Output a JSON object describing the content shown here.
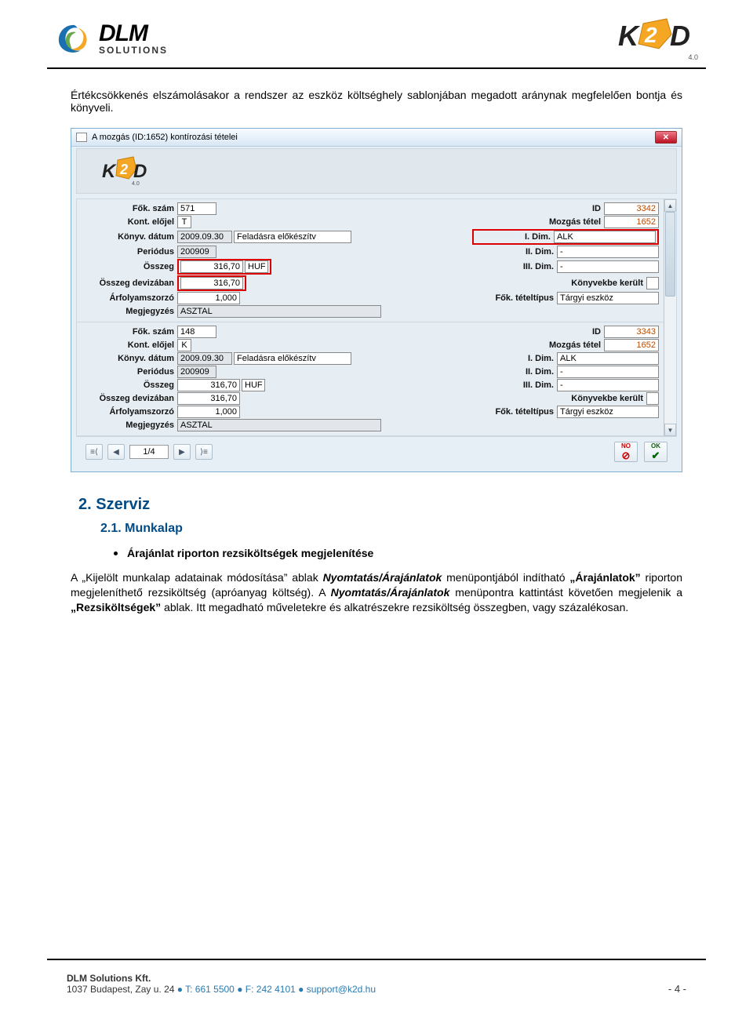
{
  "header": {
    "dlm_main": "DLM",
    "dlm_sub": "SOLUTIONS",
    "k2d_version": "4.0"
  },
  "intro_para": "Értékcsökkenés elszámolásakor a rendszer az eszköz költséghely sablonjában megadott aránynak megfelelően bontja és könyveli.",
  "window": {
    "title": "A mozgás (ID:1652) kontírozási tételei",
    "close": "✕",
    "labels": {
      "fok_szam": "Fők. szám",
      "kont_elojel": "Kont. előjel",
      "konyv_datum": "Könyv. dátum",
      "periodus": "Periódus",
      "osszeg": "Összeg",
      "osszeg_deviza": "Összeg devizában",
      "arfolyam": "Árfolyamszorzó",
      "megjegyzes": "Megjegyzés",
      "id": "ID",
      "mozgas_tetel": "Mozgás tétel",
      "dim1": "I. Dim.",
      "dim2": "II. Dim.",
      "dim3": "III. Dim.",
      "konyvekbe": "Könyvekbe került",
      "fok_tetel": "Fők. tételtípus"
    },
    "rec1": {
      "fok_szam": "571",
      "kont_elojel": "T",
      "konyv_datum": "2009.09.30",
      "statusz": "Feladásra előkészítv",
      "periodus": "200909",
      "osszeg": "316,70",
      "currency": "HUF",
      "osszeg_deviza": "316,70",
      "arfolyam": "1,000",
      "megjegyzes": "ASZTAL",
      "id": "3342",
      "mozgas_tetel": "1652",
      "dim1": "ALK",
      "dim2": "-",
      "dim3": "-",
      "fok_tetel": "Tárgyi eszköz"
    },
    "rec2": {
      "fok_szam": "148",
      "kont_elojel": "K",
      "konyv_datum": "2009.09.30",
      "statusz": "Feladásra előkészítv",
      "periodus": "200909",
      "osszeg": "316,70",
      "currency": "HUF",
      "osszeg_deviza": "316,70",
      "arfolyam": "1,000",
      "megjegyzes": "ASZTAL",
      "id": "3343",
      "mozgas_tetel": "1652",
      "dim1": "ALK",
      "dim2": "-",
      "dim3": "-",
      "fok_tetel": "Tárgyi eszköz"
    },
    "page": "1/4",
    "no": "NO",
    "ok": "OK"
  },
  "section": {
    "h2": "2.   Szerviz",
    "h3": "2.1. Munkalap",
    "bullet": "Árajánlat riporton rezsiköltségek megjelenítése"
  },
  "body": {
    "p1_a": "A „Kijelölt munkalap adatainak módosítása” ablak ",
    "p1_b": "Nyomtatás/Árajánlatok",
    "p1_c": " menüpontjából indítható ",
    "p1_d": "„Árajánlatok”",
    "p1_e": " riporton megjeleníthető rezsiköltség (apróanyag költség). A ",
    "p1_f": "Nyomtatás/Árajánlatok",
    "p1_g": " menüpontra kattintást követően megjelenik a ",
    "p1_h": "„Rezsiköltségek”",
    "p1_i": " ablak. Itt megadható műveletekre és alkatrészekre rezsiköltség összegben, vagy százalékosan."
  },
  "footer": {
    "company": "DLM Solutions Kft.",
    "addr": "1037 Budapest, Zay u. 24",
    "sep": " ● ",
    "tel": "T: 661 5500",
    "fax": "F: 242 4101",
    "mail": "support@k2d.hu",
    "page": "- 4 -"
  }
}
